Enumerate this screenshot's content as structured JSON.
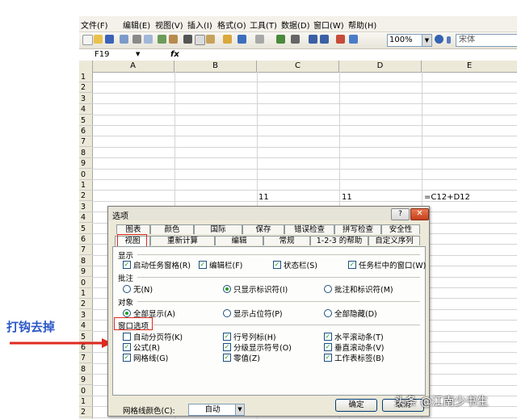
{
  "menubar": {
    "items": [
      "文件(F)",
      "编辑(E)",
      "视图(V)",
      "插入(I)",
      "格式(O)",
      "工具(T)",
      "数据(D)",
      "窗口(W)",
      "帮助(H)"
    ]
  },
  "toolbar": {
    "zoom": "100%",
    "font": "宋体"
  },
  "formula_bar": {
    "name_box": "F19",
    "fx": "fx"
  },
  "grid": {
    "columns": [
      "A",
      "B",
      "C",
      "D",
      "E"
    ],
    "rows": [
      "1",
      "2",
      "3",
      "4",
      "5",
      "6",
      "7",
      "8",
      "9",
      "0",
      "1",
      "2",
      "3",
      "4",
      "5",
      "6",
      "7",
      "8",
      "9",
      "0",
      "1",
      "2",
      "3",
      "4",
      "5",
      "6",
      "7",
      "8",
      "9",
      "0",
      "1",
      "2"
    ],
    "cells": {
      "c_row2": "11",
      "d_row2": "11",
      "e_row2": "=C12+D12"
    }
  },
  "dialog": {
    "title": "选项",
    "help": "?",
    "close": "✕",
    "tabs_row1": [
      "图表",
      "颜色",
      "国际",
      "保存",
      "错误检查",
      "拼写检查",
      "安全性"
    ],
    "tabs_row2": [
      "视图",
      "重新计算",
      "编辑",
      "常规",
      "1-2-3 的帮助",
      "自定义序列"
    ],
    "sections": {
      "show": "显示",
      "comments": "批注",
      "objects": "对象",
      "window": "窗口选项"
    },
    "show_opts": [
      "启动任务窗格(R)",
      "编辑栏(F)",
      "状态栏(S)",
      "任务栏中的窗口(W)"
    ],
    "comment_opts": [
      "无(N)",
      "只显示标识符(I)",
      "批注和标识符(M)"
    ],
    "object_opts": [
      "全部显示(A)",
      "显示占位符(P)",
      "全部隐藏(D)"
    ],
    "window_opts": [
      "自动分页符(K)",
      "行号列标(H)",
      "水平滚动条(T)",
      "公式(R)",
      "分级显示符号(O)",
      "垂直滚动条(V)",
      "网格线(G)",
      "零值(Z)",
      "工作表标签(B)"
    ],
    "gridline_color_label": "网格线颜色(C):",
    "gridline_color_value": "自动",
    "ok": "确定",
    "cancel": "取消"
  },
  "annotation": "打钩去掉",
  "watermark": "头条 @江南少书生"
}
